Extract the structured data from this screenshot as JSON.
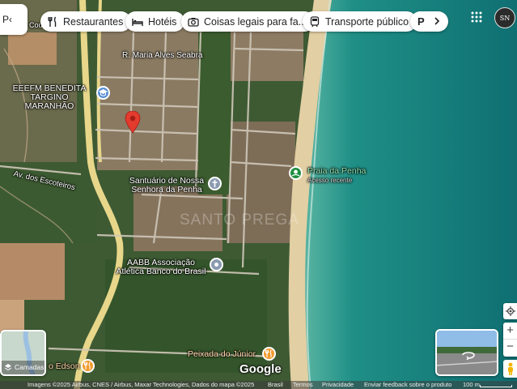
{
  "search_stub": {
    "text": "P‹"
  },
  "chips": [
    {
      "label": "Restaurantes",
      "icon": "restaurant-icon"
    },
    {
      "label": "Hotéis",
      "icon": "hotel-bed-icon"
    },
    {
      "label": "Coisas legais para fa...",
      "icon": "camera-icon"
    },
    {
      "label": "Transporte público",
      "icon": "transit-icon"
    },
    {
      "label": "P",
      "icon": "parking-icon"
    }
  ],
  "account": {
    "initials": "SN"
  },
  "map_labels": {
    "street_1": "R. Maria Alves Seabra",
    "school": "EEEFM BENEDITA\nTARGINO MARANHÃO",
    "avenue": "Av. dos Escoteiros",
    "church": "Santuário de Nossa\nSenhora da Penha",
    "beach": "Praia da Penha",
    "beach_sub": "Acesso recente",
    "club": "AABB Associação\nAtlética Banco do Brasil",
    "restaurant_1": "Peixada do Júnior",
    "restaurant_2": "o Edson",
    "watermark": "SANTO PREGA",
    "top_cut": "Cou"
  },
  "layers_button": {
    "label": "Camadas"
  },
  "google_logo": "Google",
  "zoom": {
    "in": "+",
    "out": "−"
  },
  "footer": {
    "imagery": "Imagens ©2025 Airbus, CNES / Airbus, Maxar Technologies, Dados do mapa ©2025",
    "country": "Brasil",
    "terms": "Termos",
    "privacy": "Privacidade",
    "feedback": "Enviar feedback sobre o produto",
    "scale": "100 m"
  },
  "colors": {
    "pin": "#e33b2e",
    "poi_blue": "#5b8fd6",
    "poi_orange": "#f29a2e",
    "poi_green": "#1e8e3e"
  }
}
